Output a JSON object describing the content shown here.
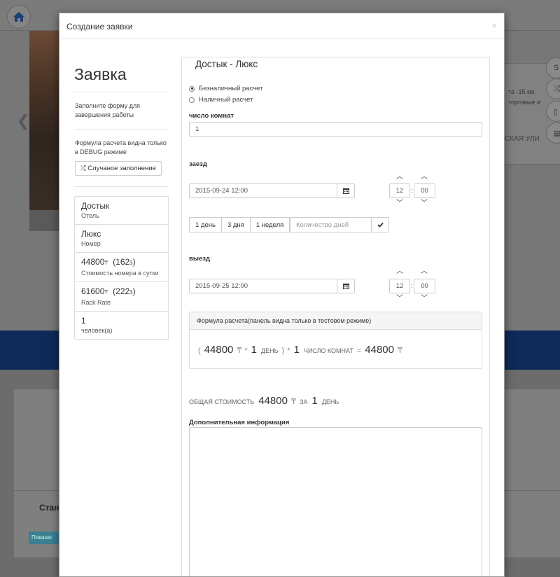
{
  "background": {
    "side_text_1": "та -15 км. торговые и",
    "side_text_2": "ШСКАЯ УЛИ",
    "side_button_s": "S",
    "card_title": "Станд",
    "card_button": "Показат"
  },
  "modal": {
    "title": "Создание заявки",
    "close": "×"
  },
  "left": {
    "heading": "Заявка",
    "note1": "Заполните форму для завершения работы",
    "note2": "Формула расчета видна только в DEBUG режиме",
    "random_button": "Случаное заполнение",
    "items": [
      {
        "main": "Достык",
        "sub": "Отель"
      },
      {
        "main": "Люкс",
        "sub": "Номер"
      },
      {
        "price": "44800",
        "usd": "162",
        "sub": "Стоимость номера в сутки"
      },
      {
        "price": "61600",
        "usd": "222",
        "sub": "Rack Rate"
      },
      {
        "main": "1",
        "sub": "человек(а)"
      }
    ],
    "tenge": "₸",
    "dollar": "$"
  },
  "form": {
    "title": "Достык - Люкс",
    "payment": {
      "option1": "Безналичный расчет",
      "option2": "Наличный расчет",
      "selected": "option1"
    },
    "rooms_label": "число комнат",
    "rooms_value": "1",
    "checkin_label": "заезд",
    "checkin_date": "2015-09-24 12:00",
    "checkin_hour": "12",
    "checkin_min": "00",
    "quick_buttons": [
      "1 день",
      "3 дня",
      "1 неделя"
    ],
    "days_placeholder": "Количество дней",
    "checkout_label": "выезд",
    "checkout_date": "2015-09-25 12:00",
    "checkout_hour": "12",
    "checkout_min": "00"
  },
  "formula": {
    "heading": "Формула расчета(панель видна только в тестовом режиме)",
    "open_paren": "(",
    "price": "44800",
    "cur": "₸",
    "times1": "*",
    "days": "1",
    "days_unit": "день",
    "close_paren": ")",
    "times2": "*",
    "rooms": "1",
    "rooms_unit": "число комнат",
    "equals": "=",
    "result": "44800",
    "result_cur": "₸"
  },
  "total": {
    "label": "общая стоимость",
    "amount": "44800",
    "cur": "₸",
    "for": "за",
    "days": "1",
    "unit": "день"
  },
  "extra_label": "Дополнительная информация",
  "extra_value": ""
}
